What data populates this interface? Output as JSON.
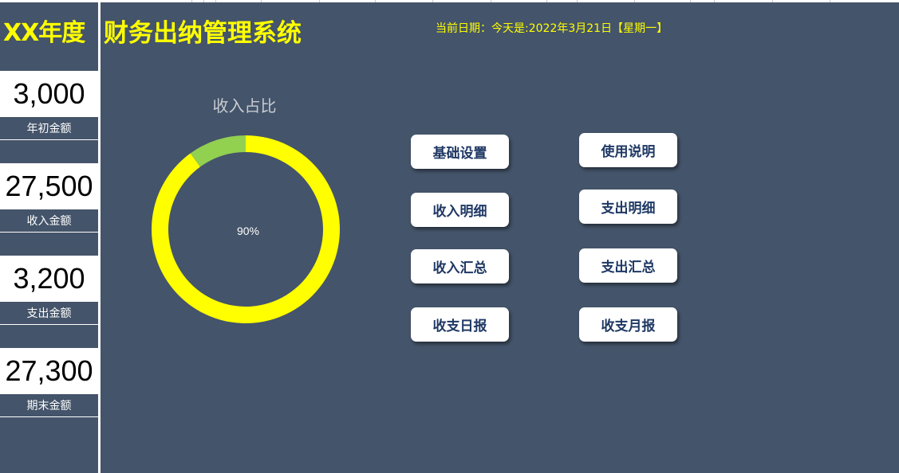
{
  "header": {
    "year_title": "XX年度",
    "app_title": "财务出纳管理系统",
    "date_line": "当前日期：今天是:2022年3月21日【星期一】"
  },
  "sidebar": {
    "stats": [
      {
        "value": "3,000",
        "label": "年初金额"
      },
      {
        "value": "27,500",
        "label": "收入金额"
      },
      {
        "value": "3,200",
        "label": "支出金额"
      },
      {
        "value": "27,300",
        "label": "期末金额"
      }
    ]
  },
  "chart_data": {
    "type": "pie",
    "title": "收入占比",
    "center_label": "90%",
    "slices": [
      {
        "value": 90,
        "color": "#ffff00"
      },
      {
        "value": 10,
        "color": "#92d050"
      }
    ]
  },
  "buttons": {
    "basic_settings": "基础设置",
    "user_guide": "使用说明",
    "income_detail": "收入明细",
    "expense_detail": "支出明细",
    "income_summary": "收入汇总",
    "expense_summary": "支出汇总",
    "daily_report": "收支日报",
    "monthly_report": "收支月报"
  },
  "colors": {
    "background": "#44546a",
    "title": "#ffff00",
    "button_text": "#1f3864"
  }
}
